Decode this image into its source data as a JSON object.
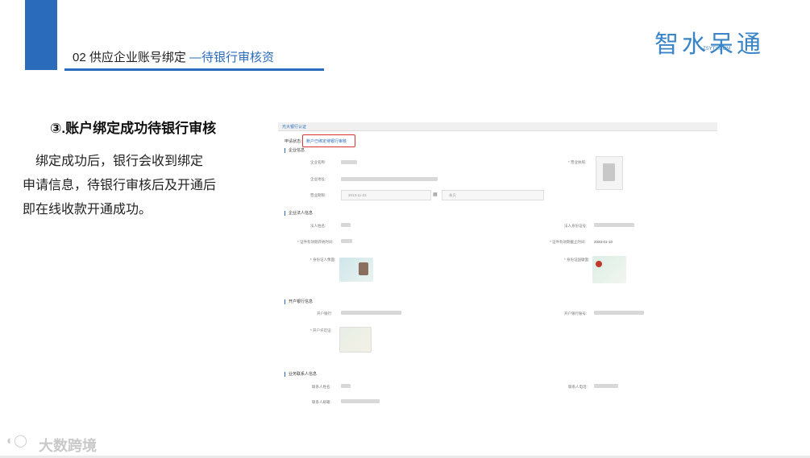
{
  "header": {
    "title_prefix": "02 供应企业账号绑定 ",
    "title_accent": "—待银行审核资"
  },
  "logo": {
    "text": "智水呆通",
    "subtext": "ZSYTY.COM"
  },
  "step": {
    "heading": "③.账户绑定成功待银行审核",
    "description_lines": [
      "　绑定成功后，银行会收到绑定",
      "申请信息，待银行审核后及开通后",
      "即在线收款开通成功。"
    ]
  },
  "screenshot": {
    "tab_label": "光大银行认证",
    "status_label": "申请状态:",
    "status_value": "账户已绑定待银行审核",
    "sections": {
      "company": "企业信息",
      "legal": "企业法人信息",
      "bank": "开户银行信息",
      "contact": "业务联系人信息"
    },
    "fields": {
      "company_name": "企业名称:",
      "company_addr": "企业地址:",
      "business_term": "营业期限:",
      "business_license": "* 营业执照:",
      "legal_name": "法人姓名:",
      "legal_id": "法人身份证号:",
      "cert_start": "* 证件有效期开始时间:",
      "cert_end": "* 证件有效期截止时间:",
      "id_front": "* 身份证人像面:",
      "id_back": "* 身份证国徽面:",
      "bank_name": "开户银行:",
      "bank_account": "开户银行账号:",
      "bank_permit": "* 开户许可证:",
      "contact_name": "联系人姓名:",
      "contact_phone": "联系人电话:",
      "contact_email": "联系人邮箱:"
    },
    "values": {
      "term_start": "2013-11-22",
      "term_end": "永久",
      "cert_end": "2033-01-10"
    }
  },
  "watermark": {
    "text": "大数跨境"
  },
  "colors": {
    "accent": "#2a6bbb",
    "status_border": "#d9332e"
  }
}
